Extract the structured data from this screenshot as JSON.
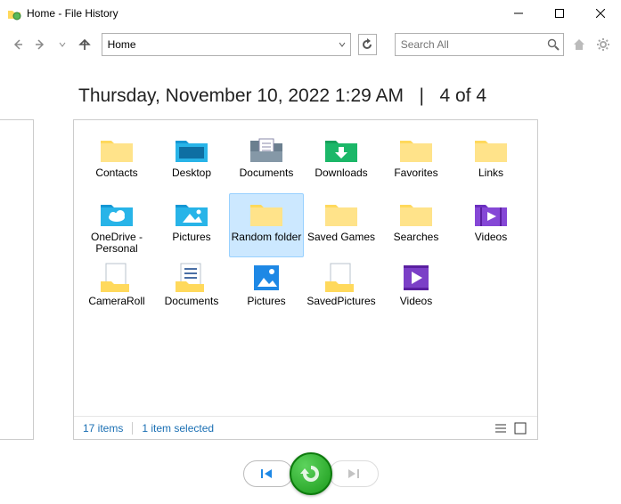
{
  "window": {
    "title": "Home - File History"
  },
  "nav": {
    "address": "Home",
    "search_placeholder": "Search All"
  },
  "heading": {
    "timestamp": "Thursday, November 10, 2022 1:29 AM",
    "pager": "4 of 4"
  },
  "items": [
    {
      "name": "Contacts",
      "label": "Contacts",
      "kind": "folder-yellow",
      "selected": false
    },
    {
      "name": "Desktop",
      "label": "Desktop",
      "kind": "folder-blue",
      "selected": false
    },
    {
      "name": "Documents",
      "label": "Documents",
      "kind": "folder-docs",
      "selected": false
    },
    {
      "name": "Downloads",
      "label": "Downloads",
      "kind": "folder-down",
      "selected": false
    },
    {
      "name": "Favorites",
      "label": "Favorites",
      "kind": "folder-yellow",
      "selected": false
    },
    {
      "name": "Links",
      "label": "Links",
      "kind": "folder-yellow",
      "selected": false
    },
    {
      "name": "OneDrive",
      "label": "OneDrive - Personal",
      "kind": "folder-cloud",
      "selected": false
    },
    {
      "name": "Pictures",
      "label": "Pictures",
      "kind": "folder-pics",
      "selected": false
    },
    {
      "name": "Random",
      "label": "Random folder",
      "kind": "folder-yellow",
      "selected": true
    },
    {
      "name": "SavedGames",
      "label": "Saved Games",
      "kind": "folder-yellow",
      "selected": false
    },
    {
      "name": "Searches",
      "label": "Searches",
      "kind": "folder-yellow",
      "selected": false
    },
    {
      "name": "Videos",
      "label": "Videos",
      "kind": "folder-vids",
      "selected": false
    },
    {
      "name": "CameraRoll",
      "label": "CameraRoll",
      "kind": "lib-cam",
      "selected": false
    },
    {
      "name": "LibDocs",
      "label": "Documents",
      "kind": "lib-docs",
      "selected": false
    },
    {
      "name": "LibPics",
      "label": "Pictures",
      "kind": "lib-pics",
      "selected": false
    },
    {
      "name": "LibSavedPics",
      "label": "SavedPictures",
      "kind": "lib-cam",
      "selected": false
    },
    {
      "name": "LibVids",
      "label": "Videos",
      "kind": "lib-vids",
      "selected": false
    }
  ],
  "status": {
    "count": "17 items",
    "selection": "1 item selected"
  }
}
